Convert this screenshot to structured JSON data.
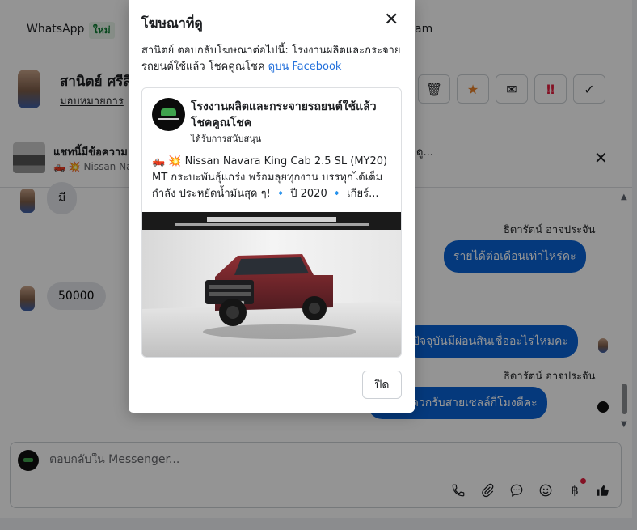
{
  "nav": {
    "whatsapp_label": "WhatsApp",
    "new_badge": "ใหม่",
    "instagram_partial": "am"
  },
  "contact": {
    "name": "สานิตย์ ศรีสิ",
    "assign_label": "มอบหมายการ"
  },
  "actions": [
    {
      "name": "delete-button",
      "icon": "trash-icon",
      "glyph": "🗑"
    },
    {
      "name": "star-button",
      "icon": "star-icon",
      "glyph": "★",
      "color": "#e8822a"
    },
    {
      "name": "mail-button",
      "icon": "envelope-icon",
      "glyph": "✉"
    },
    {
      "name": "important-button",
      "icon": "double-exclamation-icon",
      "glyph": "‼",
      "color": "#e41e3f"
    },
    {
      "name": "done-button",
      "icon": "checkmark-icon",
      "glyph": "✓"
    }
  ],
  "ad_strip": {
    "title": "แชทนี้มีข้อความ",
    "subtitle": "🛻 💥 Nissan Nav",
    "title_tail": "ดู..."
  },
  "messages": {
    "in_1": "มี",
    "sender_1": "ธิดารัตน์ อาจประจัน",
    "out_1": "รายได้ต่อเดือนเท่าไหร่คะ",
    "in_2": "50000",
    "out_2": "ปัจจุบันมีผ่อนสินเชื่ออะไรไหมคะ",
    "sender_2": "ธิดารัตน์ อาจประจัน",
    "out_3": "กค้าสะดวกรับสายเซลล์กี่โมงดีคะ"
  },
  "composer": {
    "placeholder": "ตอบกลับใน Messenger...",
    "icons": [
      "phone-icon",
      "paperclip-icon",
      "chat-bubble-icon",
      "smiley-icon",
      "baht-icon",
      "thumbs-up-icon"
    ]
  },
  "modal": {
    "title": "โฆษณาที่ดู",
    "description": "สานิตย์ ตอบกลับโฆษณาต่อไปนี้: โรงงานผลิตและกระจายรถยนต์ใช้แล้ว โชคคูณโชค",
    "link_text": "ดูบน Facebook",
    "page_name": "โรงงานผลิตและกระจายรถยนต์ใช้แล้ว โชคคูณโชค",
    "sponsored": "ได้รับการสนับสนุน",
    "ad_text": "🛻 💥 Nissan Navara King Cab 2.5 SL (MY20) MT กระบะพันธุ์แกร่ง พร้อมลุยทุกงาน บรรทุกได้เต็มกำลัง ประหยัดน้ำมันสุด ๆ! 🔹 ปี 2020 🔹 เกียร์...",
    "close_button": "ปิด"
  },
  "colors": {
    "brand_blue": "#0a63d6",
    "link_blue": "#216fdb",
    "star_orange": "#e8822a",
    "alert_red": "#e41e3f"
  }
}
